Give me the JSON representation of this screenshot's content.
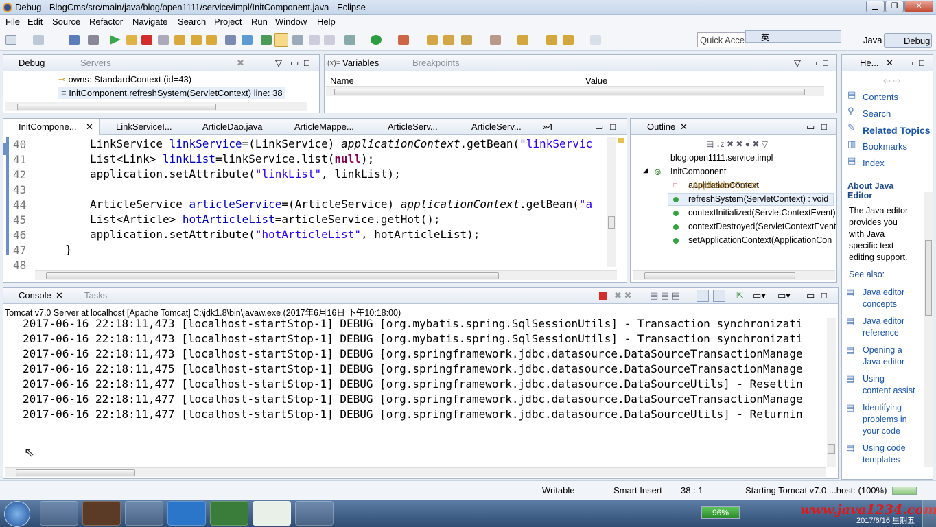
{
  "window": {
    "title": "Debug - BlogCms/src/main/java/blog/open1111/service/impl/InitComponent.java - Eclipse"
  },
  "menu": [
    "File",
    "Edit",
    "Source",
    "Refactor",
    "Navigate",
    "Search",
    "Project",
    "Run",
    "Window",
    "Help"
  ],
  "toolbar": {
    "quick_access": "Quick Access",
    "perspectives": [
      "Java",
      "Debug"
    ],
    "ime": "英"
  },
  "debug_view": {
    "tabs": [
      "Debug",
      "Servers"
    ],
    "rows": [
      "owns: StandardContext  (id=43)",
      "InitComponent.refreshSystem(ServletContext) line: 38"
    ]
  },
  "variables_view": {
    "tabs": [
      "Variables",
      "Breakpoints"
    ],
    "columns": [
      "Name",
      "Value"
    ]
  },
  "editor": {
    "tabs": [
      "InitCompone...",
      "LinkServiceI...",
      "ArticleDao.java",
      "ArticleMappe...",
      "ArticleServ...",
      "ArticleServ..."
    ],
    "overflow": "»4",
    "line_numbers": [
      "40",
      "41",
      "42",
      "43",
      "44",
      "45",
      "46",
      "47",
      "48"
    ]
  },
  "outline": {
    "tab": "Outline",
    "package": "blog.open1111.service.impl",
    "class": "InitComponent",
    "members": [
      {
        "name": "applicationContext",
        "type": " : ApplicationConte"
      },
      {
        "name": "refreshSystem(ServletContext) : void",
        "type": ""
      },
      {
        "name": "contextInitialized(ServletContextEvent)",
        "type": ""
      },
      {
        "name": "contextDestroyed(ServletContextEvent",
        "type": ""
      },
      {
        "name": "setApplicationContext(ApplicationCon",
        "type": ""
      }
    ]
  },
  "help": {
    "tab": "He...",
    "links": [
      "Contents",
      "Search",
      "Related Topics",
      "Bookmarks",
      "Index"
    ],
    "about_title": "About Java Editor",
    "about_text": [
      "The Java editor",
      "provides you",
      "with Java",
      "specific text",
      "editing support."
    ],
    "see_also": "See also:",
    "topics": [
      [
        "Java editor",
        "concepts"
      ],
      [
        "Java editor",
        "reference"
      ],
      [
        "Opening a",
        "Java editor"
      ],
      [
        "Using",
        "content assist"
      ],
      [
        "Identifying",
        "problems in",
        "your code"
      ],
      [
        "Using code",
        "templates"
      ]
    ]
  },
  "console": {
    "tabs": [
      "Console",
      "Tasks"
    ],
    "header": "Tomcat v7.0 Server at localhost [Apache Tomcat] C:\\jdk1.8\\bin\\javaw.exe (2017年6月16日 下午10:18:00)",
    "lines": [
      "2017-06-16 22:18:11,473 [localhost-startStop-1] DEBUG [org.mybatis.spring.SqlSessionUtils] - Transaction synchronizati",
      "2017-06-16 22:18:11,473 [localhost-startStop-1] DEBUG [org.mybatis.spring.SqlSessionUtils] - Transaction synchronizati",
      "2017-06-16 22:18:11,473 [localhost-startStop-1] DEBUG [org.springframework.jdbc.datasource.DataSourceTransactionManage",
      "2017-06-16 22:18:11,475 [localhost-startStop-1] DEBUG [org.springframework.jdbc.datasource.DataSourceTransactionManage",
      "2017-06-16 22:18:11,477 [localhost-startStop-1] DEBUG [org.springframework.jdbc.datasource.DataSourceUtils] - Resettin",
      "2017-06-16 22:18:11,477 [localhost-startStop-1] DEBUG [org.springframework.jdbc.datasource.DataSourceTransactionManage",
      "2017-06-16 22:18:11,477 [localhost-startStop-1] DEBUG [org.springframework.jdbc.datasource.DataSourceUtils] - Returnin"
    ]
  },
  "status": {
    "writable": "Writable",
    "insert_mode": "Smart Insert",
    "position": "38 : 1",
    "progress": "Starting Tomcat v7.0 ...host: (100%)"
  },
  "taskbar": {
    "battery": "96%",
    "date": "2017/6/16 星期五",
    "watermark": "www.java1234.com"
  }
}
